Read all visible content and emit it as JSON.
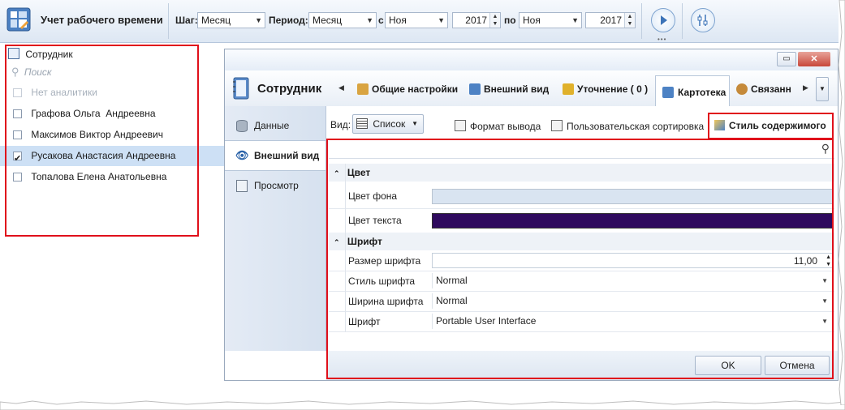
{
  "toolbar": {
    "app_title": "Учет рабочего времени",
    "step_label": "Шаг:",
    "step_value": "Месяц",
    "period_label": "Период:",
    "period_value": "Месяц",
    "from_label": "с",
    "from_month": "Ноя",
    "from_year": "2017",
    "to_label": "по",
    "to_month": "Ноя",
    "to_year": "2017"
  },
  "employee_panel": {
    "title": "Сотрудник",
    "search_placeholder": "Поиск",
    "items": [
      {
        "label": "Нет аналитики",
        "checked": false,
        "disabled": true
      },
      {
        "label": "Графова Ольга  Андреевна",
        "checked": false,
        "disabled": false
      },
      {
        "label": "Максимов Виктор Андреевич",
        "checked": false,
        "disabled": false
      },
      {
        "label": "Русакова Анастасия Андреевна",
        "checked": true,
        "disabled": false
      },
      {
        "label": "Топалова Елена Анатольевна",
        "checked": false,
        "disabled": false
      }
    ]
  },
  "dialog": {
    "window_controls": {
      "restore": "▭",
      "close": "✕"
    },
    "title": "Сотрудник",
    "tabs": [
      {
        "label": "Общие настройки"
      },
      {
        "label": "Внешний вид"
      },
      {
        "label": "Уточнение ( 0 )"
      },
      {
        "label": "Картотека"
      },
      {
        "label": "Связанн"
      }
    ],
    "side_nav": [
      {
        "label": "Данные",
        "icon": "database-icon"
      },
      {
        "label": "Внешний вид",
        "icon": "eye-icon"
      },
      {
        "label": "Просмотр",
        "icon": "preview-icon"
      }
    ],
    "view_label": "Вид:",
    "view_value": "Список",
    "format_output": "Формат вывода",
    "custom_sort": "Пользовательская сортировка",
    "content_style": "Стиль содержимого",
    "groups": {
      "color": {
        "title": "Цвет",
        "background_label": "Цвет фона",
        "background_color": "#d9e4f1",
        "text_label": "Цвет текста",
        "text_color": "#2f0a5e"
      },
      "font": {
        "title": "Шрифт",
        "size_label": "Размер шрифта",
        "size_value": "11,00",
        "style_label": "Стиль шрифта",
        "style_value": "Normal",
        "width_label": "Ширина шрифта",
        "width_value": "Normal",
        "family_label": "Шрифт",
        "family_value": "Portable User Interface"
      }
    },
    "ok_label": "OK",
    "cancel_label": "Отмена"
  },
  "colors": {
    "highlight": "#e0101b",
    "selected_row": "#cde0f5"
  }
}
